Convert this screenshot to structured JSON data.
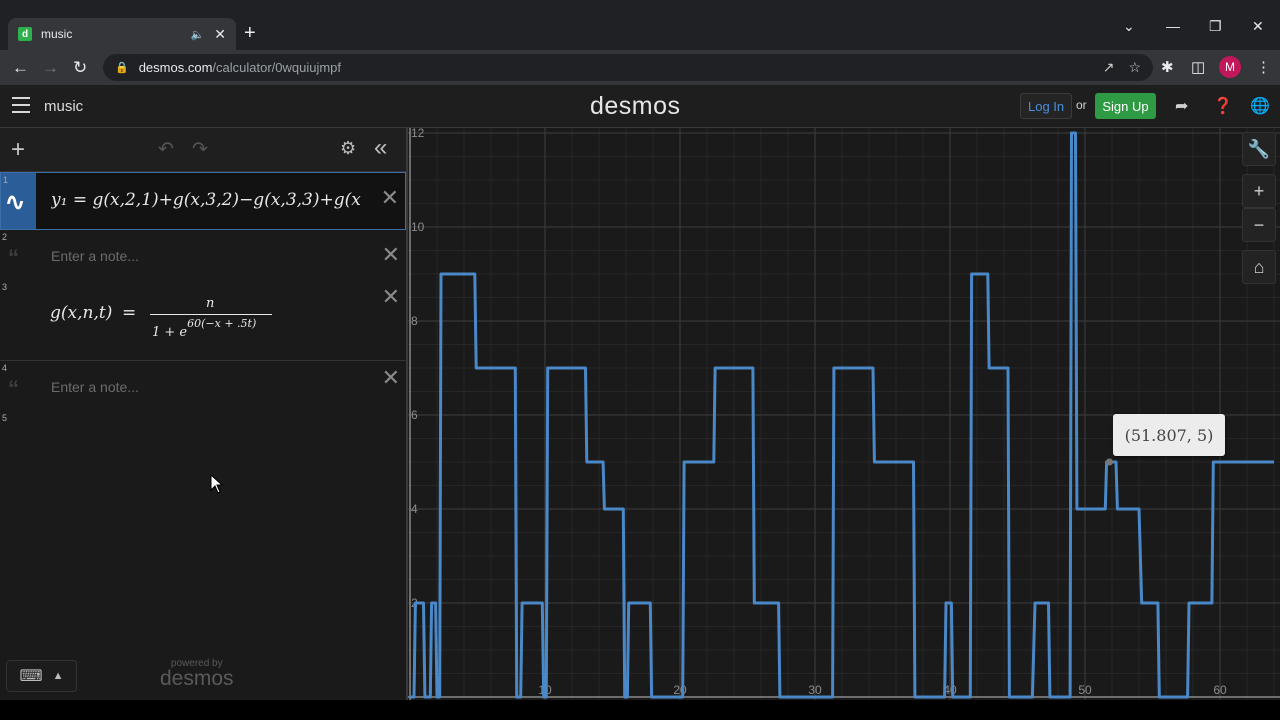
{
  "browser": {
    "tab_title": "music",
    "favicon": "d",
    "new_tab": "+",
    "url_domain": "desmos.com",
    "url_path": "/calculator/0wquiujmpf",
    "profile_initial": "M"
  },
  "header": {
    "graph_title": "music",
    "logo": "desmos",
    "login_label": "Log In",
    "or_label": "or",
    "signup_label": "Sign Up"
  },
  "expressions": [
    {
      "index": "1",
      "latex_display": "y₁ = g(x,2,1)+g(x,3,2)−g(x,3,3)+g(x"
    },
    {
      "index": "2",
      "placeholder": "Enter a note..."
    },
    {
      "index": "3",
      "lhs": "g(x,n,t)",
      "eq": "=",
      "numerator": "n",
      "den_base": "1 + e",
      "den_exp": "60(−x + .5t)"
    },
    {
      "index": "4",
      "placeholder": "Enter a note..."
    },
    {
      "index": "5"
    }
  ],
  "footer": {
    "powered_by": "powered by",
    "powered_logo": "desmos"
  },
  "graph": {
    "tooltip": "(51.807, 5)",
    "line_color": "#4a88c8",
    "x_tick_labels": [
      "10",
      "20",
      "30",
      "40",
      "50",
      "60"
    ],
    "y_tick_labels": [
      "2",
      "4",
      "6",
      "8",
      "10",
      "12"
    ]
  },
  "chart_data": {
    "type": "line",
    "title": "",
    "xlabel": "",
    "ylabel": "",
    "xlim": [
      0,
      64
    ],
    "ylim": [
      0,
      12
    ],
    "grid": true,
    "series": [
      {
        "x": [
          0,
          0.3,
          0.4,
          1.0,
          1.1,
          1.5,
          1.6,
          1.9,
          2.0,
          2.2,
          2.3,
          4.8,
          4.9,
          7.8,
          7.9,
          8.2,
          8.3,
          9.8,
          9.9,
          10.1,
          10.2,
          13.0,
          13.1,
          14.3,
          14.4,
          15.8,
          15.9,
          16.1,
          16.2,
          17.8,
          17.9,
          20.2,
          20.3,
          22.5,
          22.6,
          25.4,
          25.5,
          27.3,
          27.4,
          31.3,
          31.4,
          31.6,
          31.8,
          34.3,
          34.4,
          37.3,
          37.4,
          39.6,
          39.7,
          40.1,
          40.2,
          41.5,
          41.6,
          42.8,
          42.9,
          44.3,
          44.4,
          46.1,
          46.3,
          47.3,
          47.4,
          48.9,
          49.0,
          49.3,
          49.4,
          51.5,
          51.6,
          52.3,
          52.4,
          54.0,
          54.2,
          55.4,
          55.5,
          57.6,
          57.7,
          59.4,
          59.5,
          64
        ]
      }
    ]
  }
}
